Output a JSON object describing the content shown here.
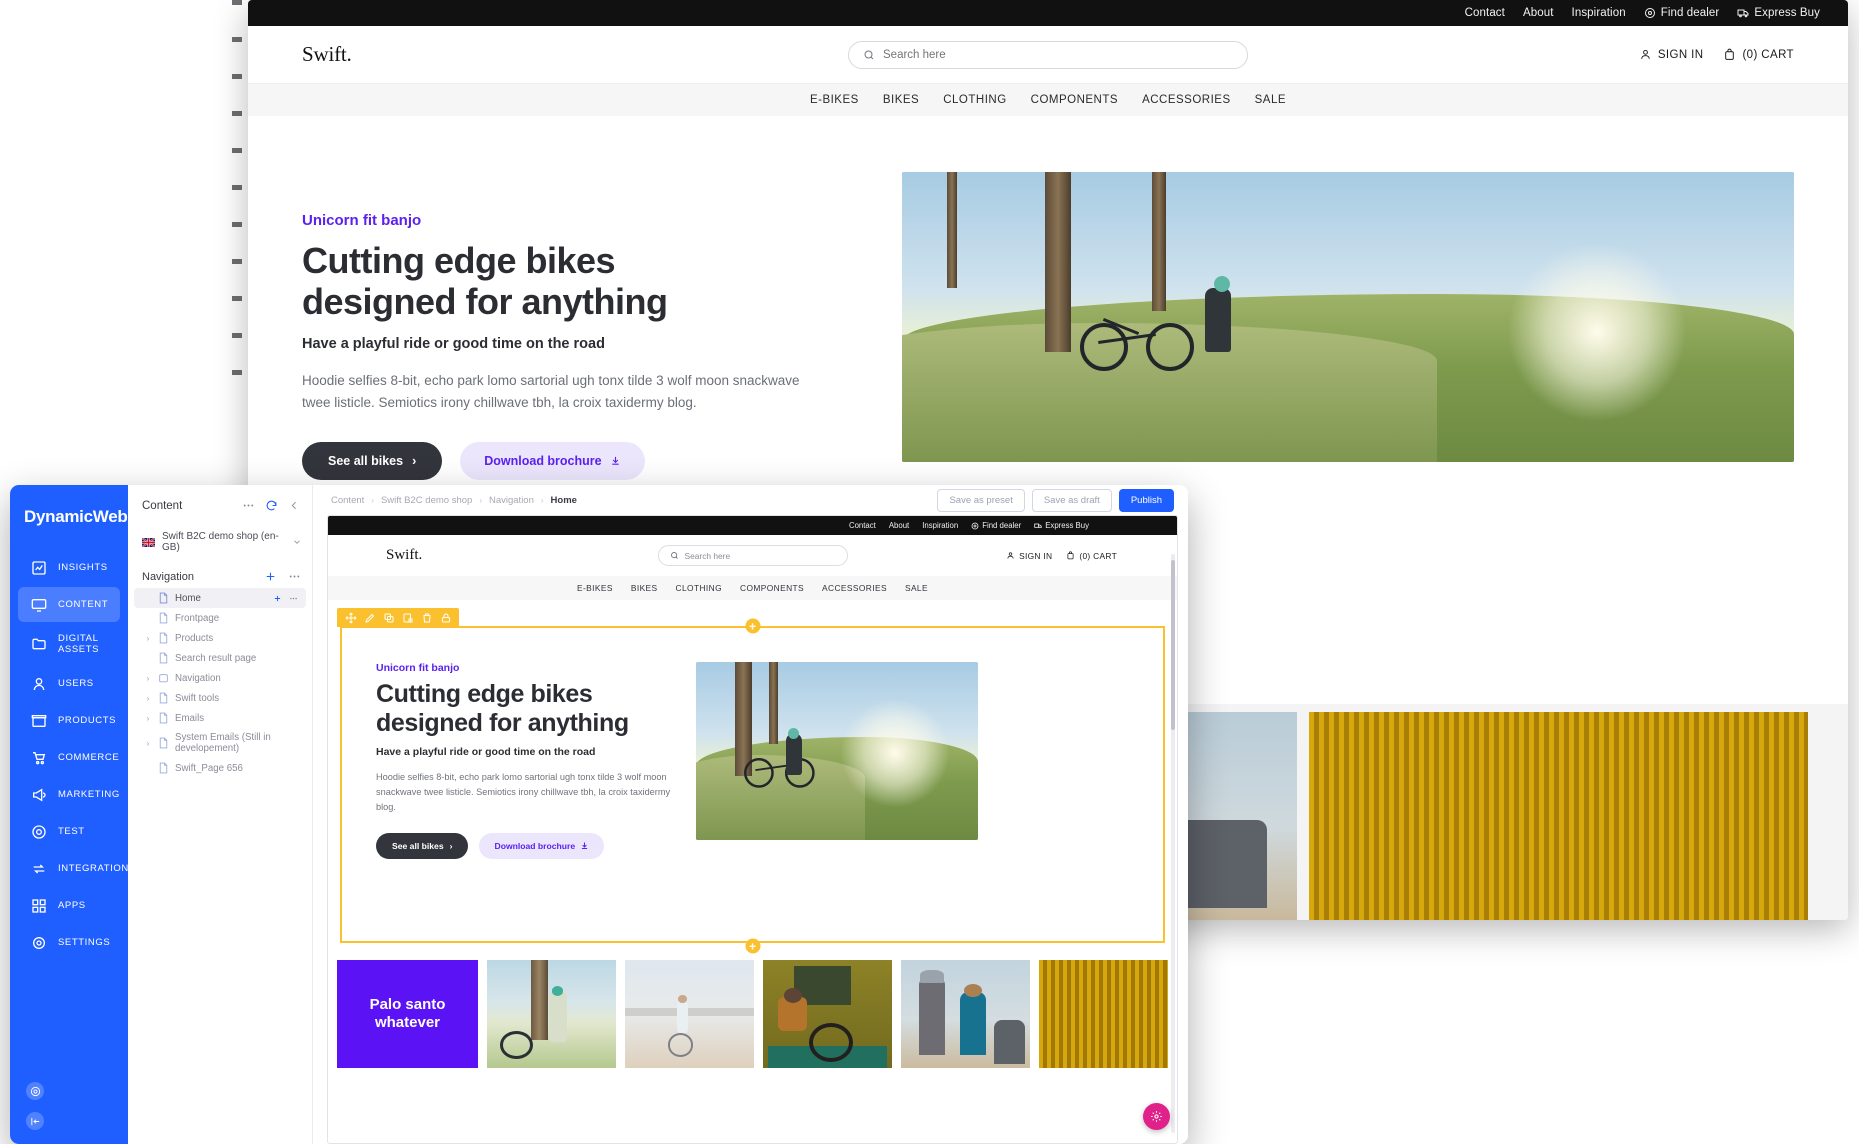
{
  "storefront": {
    "topbar_links": [
      {
        "label": "Contact",
        "icon": ""
      },
      {
        "label": "About",
        "icon": ""
      },
      {
        "label": "Inspiration",
        "icon": ""
      },
      {
        "label": "Find dealer",
        "icon": "location-pin-icon"
      },
      {
        "label": "Express Buy",
        "icon": "truck-icon"
      }
    ],
    "logo": "Swift.",
    "search_placeholder": "Search here",
    "sign_in": "SIGN IN",
    "cart": "(0) CART",
    "nav": [
      "E-BIKES",
      "BIKES",
      "CLOTHING",
      "COMPONENTS",
      "ACCESSORIES",
      "SALE"
    ],
    "hero": {
      "eyebrow": "Unicorn fit banjo",
      "title_line1": "Cutting edge bikes",
      "title_line2": "designed for anything",
      "subtitle": "Have a playful ride or good time on the road",
      "body": "Hoodie selfies 8-bit, echo park lomo sartorial ugh tonx tilde 3 wolf moon snackwave twee listicle. Semiotics irony chillwave tbh, la croix taxidermy blog.",
      "primary_button": "See all bikes",
      "secondary_button": "Download brochure"
    }
  },
  "admin": {
    "brand": "DynamicWeb",
    "rail_items": [
      {
        "label": "INSIGHTS",
        "icon": "chart-icon",
        "active": false
      },
      {
        "label": "CONTENT",
        "icon": "monitor-icon",
        "active": true
      },
      {
        "label": "DIGITAL ASSETS",
        "icon": "folder-icon",
        "active": false
      },
      {
        "label": "USERS",
        "icon": "user-icon",
        "active": false
      },
      {
        "label": "PRODUCTS",
        "icon": "box-icon",
        "active": false
      },
      {
        "label": "COMMERCE",
        "icon": "cart-icon",
        "active": false
      },
      {
        "label": "MARKETING",
        "icon": "megaphone-icon",
        "active": false
      },
      {
        "label": "TEST",
        "icon": "target-icon",
        "active": false
      },
      {
        "label": "INTEGRATION",
        "icon": "exchange-icon",
        "active": false
      },
      {
        "label": "APPS",
        "icon": "grid-icon",
        "active": false
      },
      {
        "label": "SETTINGS",
        "icon": "gear-icon",
        "active": false
      }
    ],
    "content_panel": {
      "title": "Content",
      "shop_selector": "Swift B2C demo shop (en-GB)",
      "section_label": "Navigation",
      "tree": [
        {
          "label": "Home",
          "expandable": false,
          "selected": true,
          "type": "page"
        },
        {
          "label": "Frontpage",
          "expandable": false,
          "selected": false,
          "type": "page"
        },
        {
          "label": "Products",
          "expandable": true,
          "selected": false,
          "type": "page"
        },
        {
          "label": "Search result page",
          "expandable": false,
          "selected": false,
          "type": "page"
        },
        {
          "label": "Navigation",
          "expandable": true,
          "selected": false,
          "type": "folder"
        },
        {
          "label": "Swift tools",
          "expandable": true,
          "selected": false,
          "type": "page"
        },
        {
          "label": "Emails",
          "expandable": true,
          "selected": false,
          "type": "page"
        },
        {
          "label": "System Emails (Still in developement)",
          "expandable": true,
          "selected": false,
          "type": "page"
        },
        {
          "label": "Swift_Page 656",
          "expandable": false,
          "selected": false,
          "type": "page"
        }
      ]
    },
    "breadcrumb": [
      "Content",
      "Swift B2C demo shop",
      "Navigation",
      "Home"
    ],
    "actions": {
      "save_as_preset": "Save as preset",
      "save_as_draft": "Save as draft",
      "publish": "Publish"
    },
    "edit_toolbar_icons": [
      "move-icon",
      "edit-pencil-icon",
      "copy-icon",
      "paste-icon",
      "delete-icon",
      "lock-icon"
    ],
    "add_badge": "+",
    "fab_icon": "gear-icon"
  },
  "preview": {
    "tiles": [
      {
        "type": "text",
        "label": "Palo santo whatever"
      },
      {
        "type": "photo",
        "label": "bike-leaning-tree-photo"
      },
      {
        "type": "photo",
        "label": "cyclist-desert-photo"
      },
      {
        "type": "photo",
        "label": "man-bike-yellow-wall-photo"
      },
      {
        "type": "photo",
        "label": "friends-cheers-photo"
      },
      {
        "type": "photo",
        "label": "gold-stripes-photo"
      }
    ]
  },
  "colors": {
    "brand_blue": "#1f5eff",
    "accent_purple": "#5b21f0",
    "editor_yellow": "#fbc02d",
    "fab_pink": "#e0218a",
    "dark_button": "#33353c",
    "tile_purple": "#5b13f5"
  }
}
